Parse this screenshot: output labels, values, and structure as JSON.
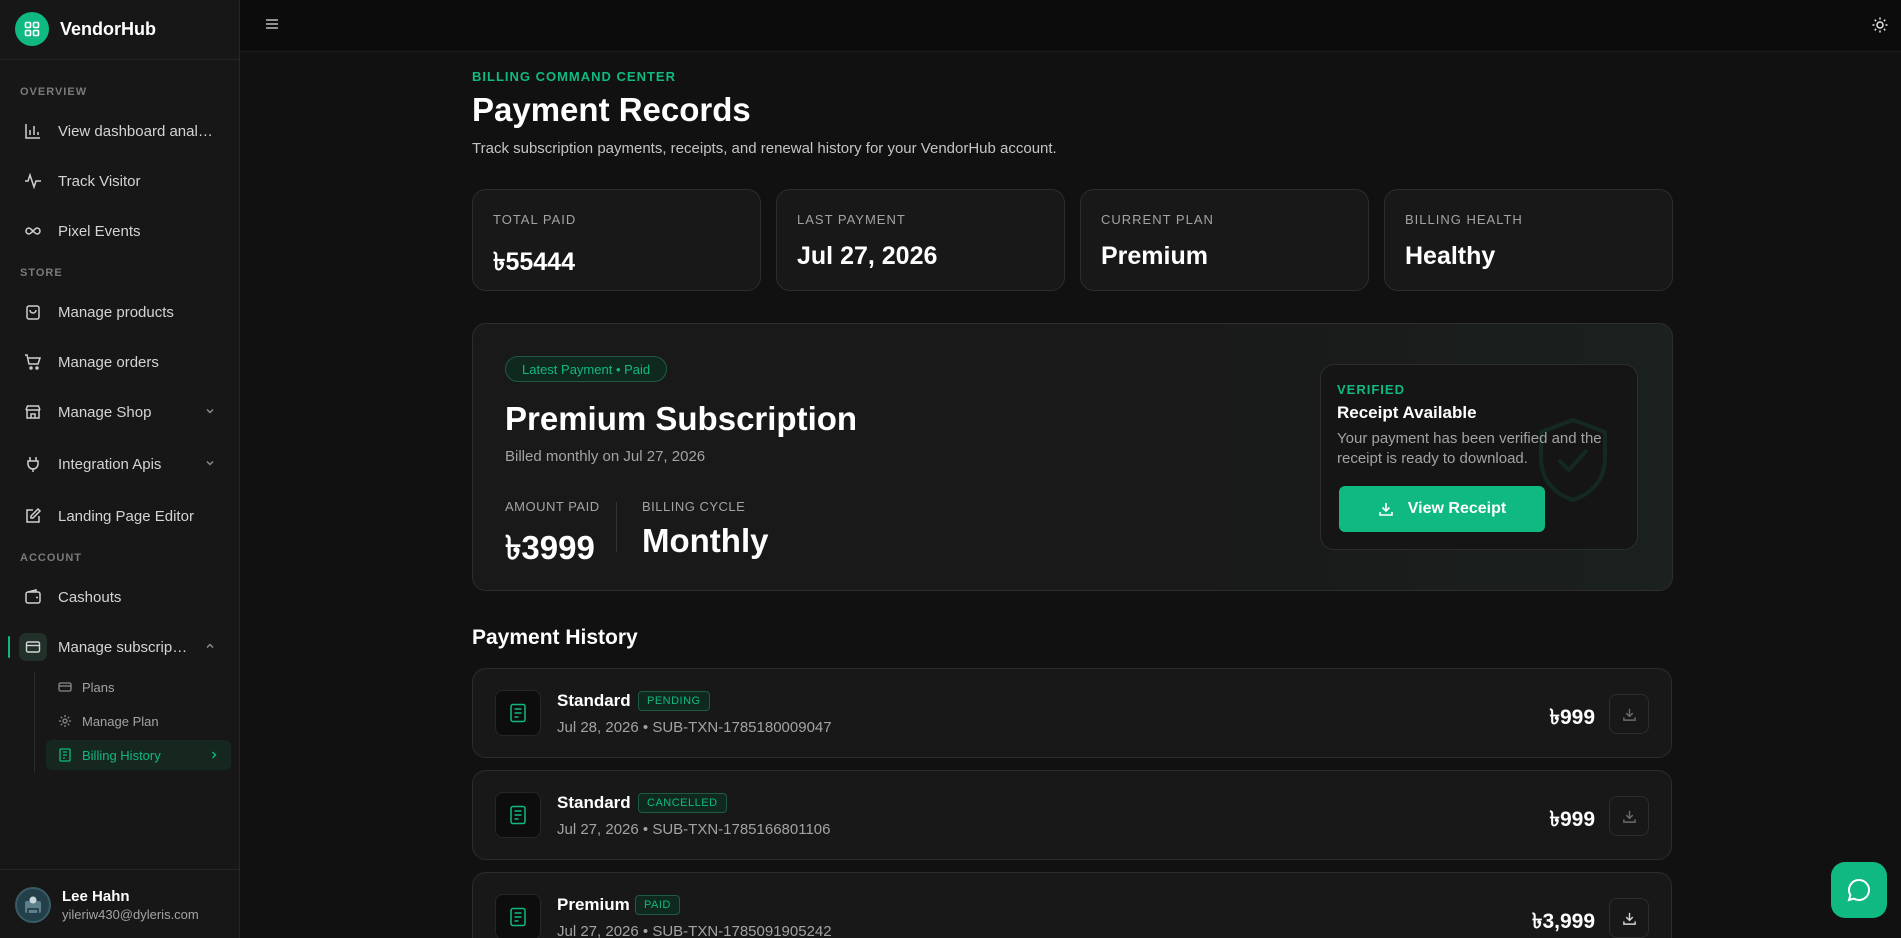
{
  "brand": {
    "name": "VendorHub"
  },
  "sidebar": {
    "sections": {
      "overview": "OVERVIEW",
      "store": "STORE",
      "account": "ACCOUNT"
    },
    "items": [
      {
        "label": "View dashboard analytics",
        "icon": "bar-chart-icon"
      },
      {
        "label": "Track Visitor",
        "icon": "activity-icon"
      },
      {
        "label": "Pixel Events",
        "icon": "infinity-icon"
      },
      {
        "label": "Manage products",
        "icon": "shopping-bag-icon"
      },
      {
        "label": "Manage orders",
        "icon": "cart-icon"
      },
      {
        "label": "Manage Shop",
        "icon": "store-icon"
      },
      {
        "label": "Integration Apis",
        "icon": "plug-icon"
      },
      {
        "label": "Landing Page Editor",
        "icon": "edit-icon"
      },
      {
        "label": "Cashouts",
        "icon": "wallet-icon"
      },
      {
        "label": "Manage subscriptions",
        "icon": "credit-card-icon"
      }
    ],
    "subitems": [
      {
        "label": "Plans",
        "icon": "card-icon"
      },
      {
        "label": "Manage Plan",
        "icon": "gear-icon"
      },
      {
        "label": "Billing History",
        "icon": "receipt-icon"
      }
    ]
  },
  "user": {
    "name": "Lee Hahn",
    "email": "yileriw430@dyleris.com"
  },
  "header": {
    "eyebrow": "BILLING COMMAND CENTER",
    "title": "Payment Records",
    "subtitle": "Track subscription payments, receipts, and renewal history for your VendorHub account."
  },
  "stats": [
    {
      "label": "TOTAL PAID",
      "value": "৳55444"
    },
    {
      "label": "LAST PAYMENT",
      "value": "Jul 27, 2026"
    },
    {
      "label": "CURRENT PLAN",
      "value": "Premium"
    },
    {
      "label": "BILLING HEALTH",
      "value": "Healthy"
    }
  ],
  "latest": {
    "badge": "Latest Payment • Paid",
    "title": "Premium Subscription",
    "billed": "Billed monthly on Jul 27, 2026",
    "amount_label": "AMOUNT PAID",
    "amount": "৳3999",
    "cycle_label": "BILLING CYCLE",
    "cycle": "Monthly"
  },
  "receipt": {
    "status": "VERIFIED",
    "title": "Receipt Available",
    "text": "Your payment has been verified and the receipt is ready to download.",
    "button": "View Receipt"
  },
  "history": {
    "title": "Payment History",
    "rows": [
      {
        "plan": "Standard",
        "status": "PENDING",
        "meta": "Jul 28, 2026 • SUB-TXN-1785180009047",
        "amount": "৳999"
      },
      {
        "plan": "Standard",
        "status": "CANCELLED",
        "meta": "Jul 27, 2026 • SUB-TXN-1785166801106",
        "amount": "৳999"
      },
      {
        "plan": "Premium",
        "status": "PAID",
        "meta": "Jul 27, 2026 • SUB-TXN-1785091905242",
        "amount": "৳3,999"
      }
    ]
  },
  "colors": {
    "accent": "#10b981",
    "background": "#111111",
    "card": "#181818"
  }
}
